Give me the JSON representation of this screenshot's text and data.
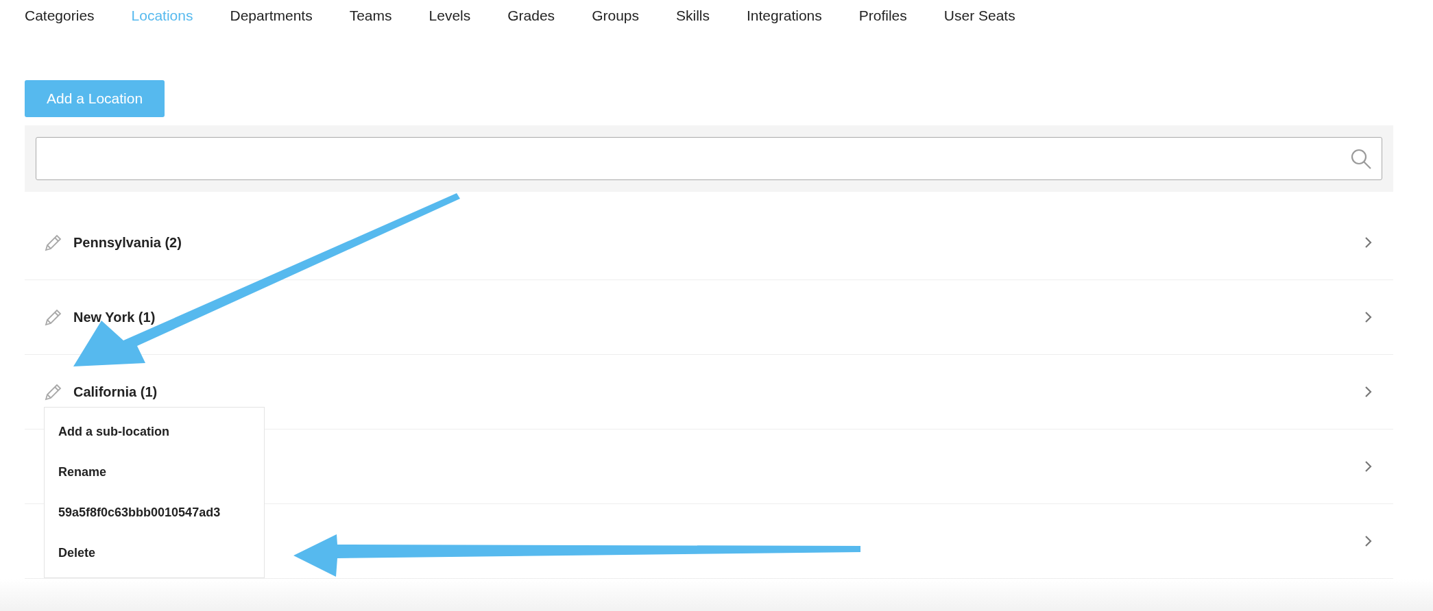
{
  "tabs": [
    {
      "label": "Categories",
      "selected": false
    },
    {
      "label": "Locations",
      "selected": true
    },
    {
      "label": "Departments",
      "selected": false
    },
    {
      "label": "Teams",
      "selected": false
    },
    {
      "label": "Levels",
      "selected": false
    },
    {
      "label": "Grades",
      "selected": false
    },
    {
      "label": "Groups",
      "selected": false
    },
    {
      "label": "Skills",
      "selected": false
    },
    {
      "label": "Integrations",
      "selected": false
    },
    {
      "label": "Profiles",
      "selected": false
    },
    {
      "label": "User Seats",
      "selected": false
    }
  ],
  "add_button": "Add a Location",
  "rows": [
    {
      "label": "Pennsylvania (2)"
    },
    {
      "label": "New York (1)"
    },
    {
      "label": "California (1)",
      "menu": [
        "Add a sub-location",
        "Rename",
        "59a5f8f0c63bbb0010547ad3",
        "Delete"
      ]
    },
    {},
    {}
  ]
}
